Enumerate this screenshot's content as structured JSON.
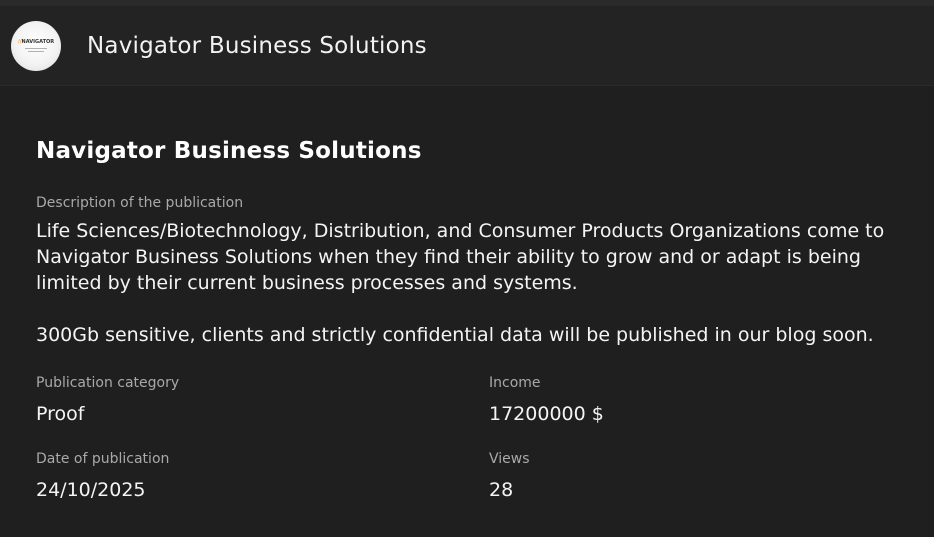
{
  "header": {
    "title": "Navigator Business Solutions",
    "avatar_logo_text": "NAVIGATOR",
    "avatar_icon": "company-logo"
  },
  "publication": {
    "title": "Navigator Business Solutions",
    "description_label": "Description of the publication",
    "description": "Life Sciences/Biotechnology, Distribution, and Consumer Products Organizations come to Navigator Business Solutions when they find their ability to grow and or adapt is being limited by their current business processes and systems.\n\n300Gb sensitive, clients and strictly confidential data will be published in our blog soon.",
    "category_label": "Publication category",
    "category": "Proof",
    "income_label": "Income",
    "income": "17200000 $",
    "date_label": "Date of publication",
    "date": "24/10/2025",
    "views_label": "Views",
    "views": "28"
  },
  "colors": {
    "background": "#1f1f1f",
    "header_background": "#232323",
    "label": "#a9a9a9",
    "text": "#f4f4f4"
  }
}
